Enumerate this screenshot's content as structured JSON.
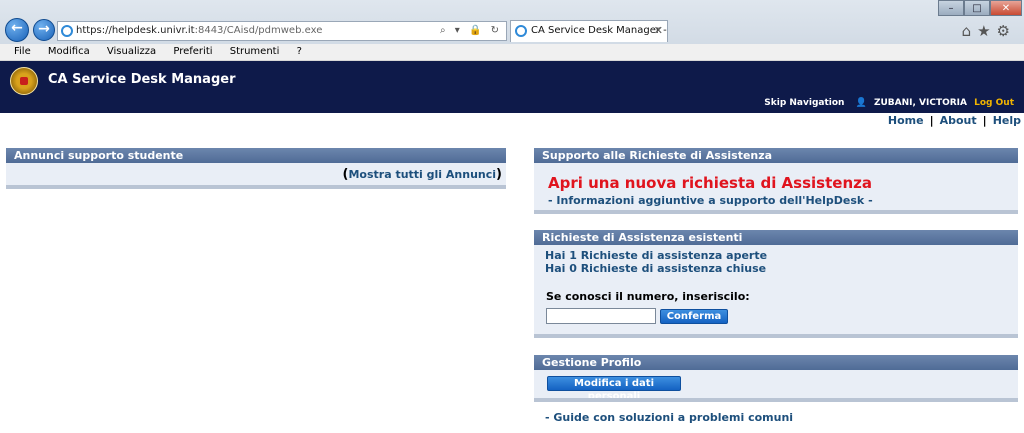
{
  "browser": {
    "url_host": "https://helpdesk.univr.it",
    "url_path": ":8443/CAisd/pdmweb.exe",
    "address_controls": "⌕ ▾ 🔒 ↻",
    "tab_title": "CA Service Desk Manager - ...",
    "tab_close": "✕",
    "back": "←",
    "forward": "→",
    "min": "–",
    "max": "□",
    "close": "✕",
    "toolbar_icons": "⌂★⚙",
    "menu": [
      "File",
      "Modifica",
      "Visualizza",
      "Preferiti",
      "Strumenti",
      "?"
    ]
  },
  "header": {
    "title": "CA Service Desk Manager",
    "skip": "Skip Navigation",
    "person_icon": "👤",
    "user": "ZUBANI, VICTORIA",
    "logout": "Log Out"
  },
  "toplinks": {
    "home": "Home",
    "about": "About",
    "help": "Help",
    "sep": "|"
  },
  "left_panel": {
    "title": "Annunci supporto studente",
    "open_paren": "(",
    "link": "Mostra tutti gli Annunci",
    "close_paren": ")"
  },
  "support_panel": {
    "title": "Supporto alle Richieste di Assistenza",
    "new_request": "Apri una nuova richiesta di Assistenza",
    "info_link": "- Informazioni aggiuntive a supporto dell'HelpDesk -"
  },
  "existing_panel": {
    "title": "Richieste di Assistenza esistenti",
    "open_link": "Hai 1 Richieste di assistenza aperte",
    "closed_link": "Hai 0 Richieste di assistenza chiuse",
    "number_label": "Se conosci il numero, inseriscilo:",
    "number_value": "",
    "confirm": "Conferma"
  },
  "profile_panel": {
    "title": "Gestione Profilo",
    "edit_button": "Modifica i dati personali"
  },
  "guide_link": "- Guide con soluzioni a problemi comuni",
  "colors": {
    "header_bg": "#0e1a4a",
    "panel_bar": "#5a76a0",
    "link": "#1d4f7c",
    "highlight_red": "#e0141e",
    "logout": "#f1b400"
  }
}
